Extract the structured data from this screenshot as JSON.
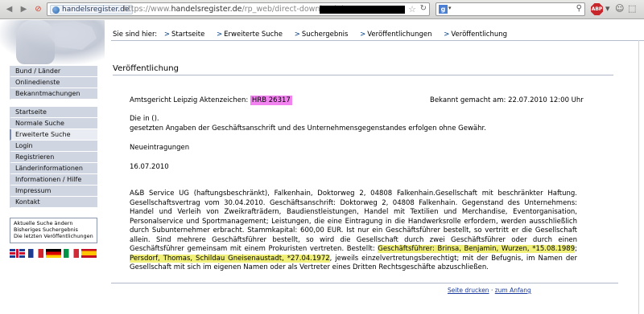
{
  "browser": {
    "site_badge": "handelsregister.de",
    "url_prefix": "https://www.",
    "url_domain": "handelsregister.de",
    "url_path": "/rp_web/direct-download.do",
    "search_engine_icon": "google-icon"
  },
  "breadcrumb": {
    "prefix": "Sie sind hier:",
    "items": [
      "Startseite",
      "Erweiterte Suche",
      "Suchergebnis",
      "Veröffentlichungen",
      "Veröffentlichung"
    ]
  },
  "sidebar": {
    "group1": [
      "Bund / Länder",
      "Onlinedienste",
      "Bekanntmachungen"
    ],
    "group2": [
      "Startseite",
      "Normale Suche",
      "Erweiterte Suche",
      "Login",
      "Registrieren",
      "Länderinformationen",
      "Informationen / Hilfe",
      "Impressum",
      "Kontakt"
    ],
    "active": "Erweiterte Suche",
    "quick_links": [
      "Aktuelle Suche ändern",
      "Bisheriges Suchergebnis",
      "Die letzten Veröffentlichungen"
    ],
    "flags": [
      "uk-flag-icon",
      "fr-flag-icon",
      "de-flag-icon",
      "it-flag-icon",
      "es-flag-icon"
    ]
  },
  "main": {
    "title": "Veröffentlichung",
    "court_label": "Amtsgericht Leipzig Aktenzeichen:",
    "case_number": "HRB 26317",
    "announced": "Bekannt gemacht am: 22.07.2010 12:00 Uhr",
    "line1": "Die in ().",
    "line2": "gesetzten Angaben der Geschäftsanschrift und des Unternehmensgegenstandes erfolgen ohne Gewähr.",
    "category": "Neueintragungen",
    "date": "16.07.2010",
    "body_start": "A&B Service UG (haftungsbeschränkt), Falkenhain, Doktorweg 2, 04808 Falkenhain.Gesellschaft mit beschränkter Haftung. Gesellschaftsvertrag vom 30.04.2010. Geschäftsanschrift: Doktorweg 2, 04808 Falkenhain. Gegenstand des Unternehmens: Handel und Verleih von Zweikrafträdern, Baudienstleistungen, Handel mit Textilien und Merchandise, Eventorganisation, Personalservice und Sportmanagement; Leistungen, die eine Eintragung in die Handwerksrolle erfordern, werden ausschließlich durch Subunternehmer erbracht. Stammkapital: 600,00 EUR. Ist nur ein Geschäftsführer bestellt, so vertritt er die Gesellschaft allein. Sind mehrere Geschäftsführer bestellt, so wird die Gesellschaft durch zwei Geschäftsführer oder durch einen Geschäftsführer gemeinsam mit einem Prokuristen vertreten. Bestellt: ",
    "highlight1": "Geschäftsführer: Brinsa, Benjamin, Wurzen, *15.08.1989",
    "sep": "; ",
    "highlight2": "Persdorf, Thomas, Schildau Gneisenaustadt, *27.04.1972",
    "body_end": ", jeweils einzelvertretungsberechtigt; mit der Befugnis, im Namen der Gesellschaft mit sich im eigenen Namen oder als Vertreter eines Dritten Rechtsgeschäfte abzuschließen."
  },
  "footer": {
    "print": "Seite drucken",
    "separator": "·",
    "top": "zum Anfang"
  },
  "colors": {
    "sidebar_bg": "#cfd5e1",
    "case_highlight": "#f282ef",
    "text_highlight": "#f0f07a",
    "link": "#1a3a9e"
  }
}
